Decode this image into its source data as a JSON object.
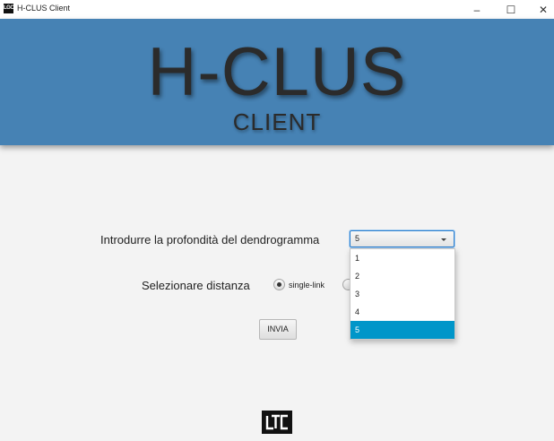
{
  "window": {
    "title": "H-CLUS Client",
    "app_icon_text": "LGC",
    "minimize_glyph": "–",
    "maximize_glyph": "☐",
    "close_glyph": "✕"
  },
  "banner": {
    "title": "H-CLUS",
    "subtitle": "CLIENT",
    "background_color": "#4682b4"
  },
  "form": {
    "depth_label": "Introdurre la profondità del dendrogramma",
    "depth_selected": "5",
    "depth_options": [
      "1",
      "2",
      "3",
      "4",
      "5"
    ],
    "distance_label": "Selezionare distanza",
    "distance_option_1": "single-link",
    "submit_label": "INVIA"
  },
  "footer": {
    "logo_icon": "lgc-logo-icon"
  },
  "colors": {
    "accent": "#0096c9",
    "focus_border": "#2b7fcf"
  }
}
